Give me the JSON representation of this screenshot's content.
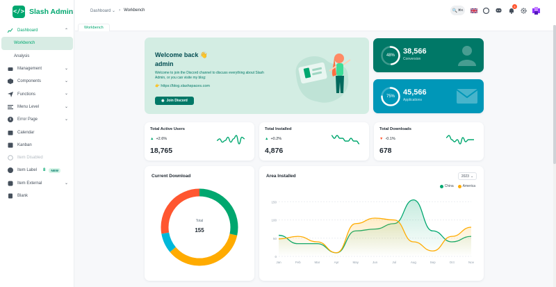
{
  "app": {
    "name": "Slash Admin",
    "logo_glyph": "</>",
    "accent": "#00a76f"
  },
  "sidebar": {
    "items": [
      {
        "label": "Dashboard",
        "icon": "chart-line-icon",
        "expanded": true
      },
      {
        "label": "Workbench",
        "active": true
      },
      {
        "label": "Analysis"
      },
      {
        "label": "Management",
        "icon": "briefcase-icon"
      },
      {
        "label": "Components",
        "icon": "cube-icon"
      },
      {
        "label": "Functions",
        "icon": "send-icon"
      },
      {
        "label": "Menu Level",
        "icon": "menu-icon"
      },
      {
        "label": "Error Page",
        "icon": "error-icon"
      },
      {
        "label": "Calendar",
        "icon": "calendar-icon"
      },
      {
        "label": "Kanban",
        "icon": "kanban-icon"
      },
      {
        "label": "Item Disabled",
        "icon": "ban-icon",
        "disabled": true
      },
      {
        "label": "Item Label",
        "icon": "tag-icon",
        "badge": "8",
        "tag": "NEW"
      },
      {
        "label": "Item External",
        "icon": "link-icon"
      },
      {
        "label": "Blank",
        "icon": "file-icon"
      }
    ]
  },
  "header": {
    "breadcrumb": [
      "Dashboard",
      "Workbench"
    ]
  },
  "tabs": [
    {
      "label": "Workbench"
    }
  ],
  "welcome": {
    "title_line1": "Welcome back 👋",
    "title_line2": "admin",
    "desc": "Welcome to join the Discord channel to discuss everything about Slash Admin, or you can visite my blog:",
    "link": "https://blog.slashspaces.com",
    "button": "Join Discord"
  },
  "stats": [
    {
      "percent": "48%",
      "value": "38,566",
      "label": "Conversion",
      "fraction": 0.48,
      "color": "#007867"
    },
    {
      "percent": "75%",
      "value": "45,566",
      "label": "Applications",
      "fraction": 0.75,
      "color": "#0097b8"
    }
  ],
  "mini_cards": [
    {
      "title": "Total Active Users",
      "trend": "+2.6%",
      "trend_dir": "up",
      "value": "18,765",
      "spark": [
        4,
        5,
        3,
        4,
        6,
        3,
        5,
        7,
        2,
        6,
        5
      ],
      "color": "#00a76f"
    },
    {
      "title": "Total Installed",
      "trend": "+0.2%",
      "trend_dir": "up",
      "value": "4,876",
      "spark": [
        6,
        5,
        6,
        5,
        5,
        4,
        4,
        5,
        4,
        4,
        3
      ],
      "color": "#00a76f"
    },
    {
      "title": "Total Downloads",
      "trend": "-0.1%",
      "trend_dir": "down",
      "value": "678",
      "spark": [
        5,
        6,
        4,
        3,
        4,
        2,
        5,
        3,
        4,
        4,
        4
      ],
      "color": "#00a76f"
    }
  ],
  "current_download": {
    "title": "Current Download",
    "total_label": "Total",
    "total_value": "155"
  },
  "area_installed": {
    "title": "Area Installed",
    "year": "2023",
    "legend": [
      "China",
      "America"
    ]
  },
  "chart_data": [
    {
      "type": "pie",
      "title": "Current Download",
      "categories": [
        "Green",
        "Yellow",
        "Cyan",
        "Red"
      ],
      "values": [
        44,
        55,
        13,
        43
      ],
      "colors": [
        "#00a76f",
        "#ffab00",
        "#00b8d9",
        "#ff5630"
      ]
    },
    {
      "type": "area",
      "title": "Area Installed",
      "categories": [
        "Jan",
        "Feb",
        "Mar",
        "Apr",
        "May",
        "Jun",
        "Jul",
        "Aug",
        "Sep",
        "Oct",
        "Nov"
      ],
      "series": [
        {
          "name": "China",
          "values": [
            58,
            35,
            35,
            10,
            70,
            75,
            90,
            155,
            70,
            40,
            55
          ],
          "color": "#00a76f"
        },
        {
          "name": "America",
          "values": [
            48,
            55,
            40,
            10,
            90,
            105,
            100,
            40,
            15,
            55,
            80
          ],
          "color": "#ffab00"
        }
      ],
      "yticks": [
        0,
        50,
        100,
        150
      ],
      "ylim": [
        0,
        160
      ]
    }
  ]
}
